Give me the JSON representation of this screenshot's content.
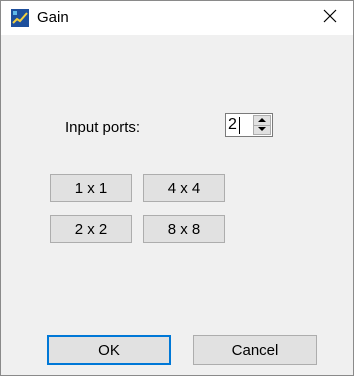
{
  "window": {
    "title": "Gain",
    "icon": "simulink-app-icon",
    "close_icon": "close-icon"
  },
  "ports": {
    "label": "Input ports:",
    "value": "2"
  },
  "presets": [
    {
      "label": "1 x 1"
    },
    {
      "label": "4 x 4"
    },
    {
      "label": "2 x 2"
    },
    {
      "label": "8 x 8"
    }
  ],
  "footer": {
    "ok_label": "OK",
    "cancel_label": "Cancel"
  },
  "colors": {
    "focus_border": "#0078d7",
    "button_face": "#e1e1e1",
    "dialog_background": "#f0f0f0"
  }
}
